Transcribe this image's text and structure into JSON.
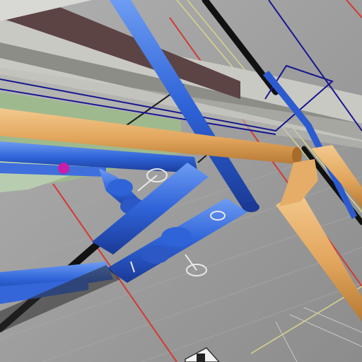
{
  "view": {
    "kind": "3D BIM model viewport",
    "colors": {
      "floor": "#9c9c9c",
      "floor_dark": "#7e7e7e",
      "slab_top": "#c9c9c4",
      "slab_side": "#8d8d88",
      "beam_brown": "#5c4344",
      "green_panel": "#9fb98e",
      "blue_pipe": "#2f63d8",
      "blue_pipe_dark": "#1a3a96",
      "blue_pipe_light": "#6d9cf2",
      "orange_pipe": "#e2a55c",
      "orange_pipe_light": "#f3c98e",
      "orange_pipe_dark": "#b77a35",
      "red_line": "#d23a33",
      "yellow_line": "#d8d28a",
      "navy_line": "#17178f",
      "black_rail": "#111111",
      "magenta_fitting": "#c81ea8"
    }
  }
}
